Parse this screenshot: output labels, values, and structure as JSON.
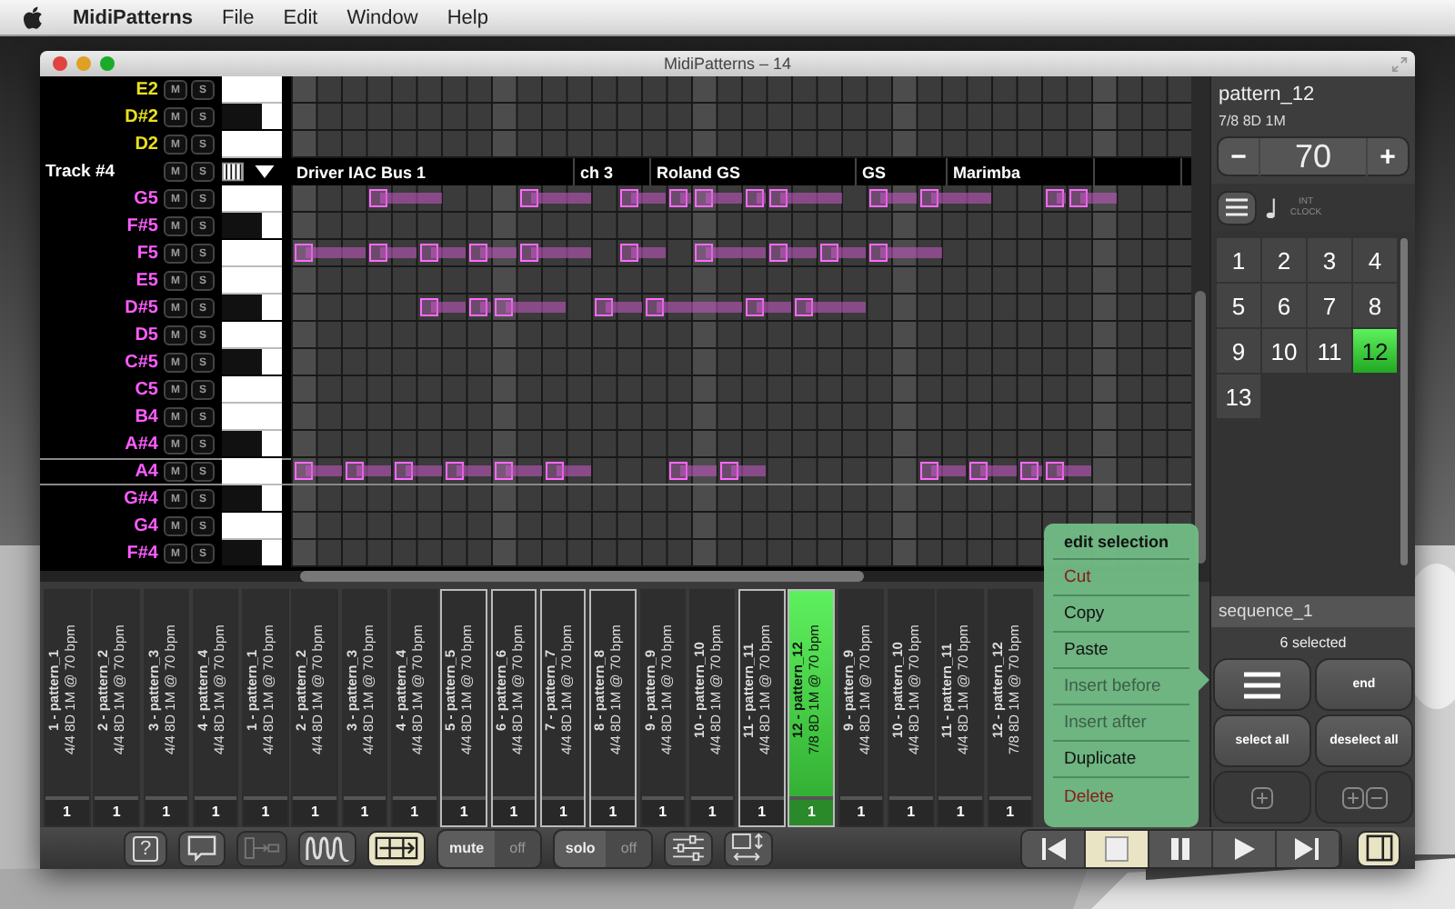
{
  "menu_bar": {
    "app": "MidiPatterns",
    "items": [
      "File",
      "Edit",
      "Window",
      "Help"
    ]
  },
  "window": {
    "title": "MidiPatterns – 14"
  },
  "tracks": [
    {
      "color": "#e8e020",
      "rows": [
        {
          "note": "E2",
          "kind": "white",
          "mute": "M",
          "solo": "S",
          "selected": false
        },
        {
          "note": "D#2",
          "kind": "black",
          "mute": "M",
          "solo": "S",
          "selected": false
        },
        {
          "note": "D2",
          "kind": "white",
          "mute": "M",
          "solo": "S",
          "selected": false
        }
      ]
    },
    {
      "color": "#ff5cff",
      "header": {
        "name": "Track #4",
        "mute": "M",
        "solo": "S",
        "segments": [
          "Driver IAC Bus 1",
          "ch 3",
          "Roland GS",
          "GS",
          "Marimba"
        ]
      },
      "rows": [
        {
          "note": "G5",
          "kind": "white",
          "mute": "M",
          "solo": "S",
          "selected": false
        },
        {
          "note": "F#5",
          "kind": "black",
          "mute": "M",
          "solo": "S",
          "selected": false
        },
        {
          "note": "F5",
          "kind": "white",
          "mute": "M",
          "solo": "S",
          "selected": false
        },
        {
          "note": "E5",
          "kind": "white",
          "mute": "M",
          "solo": "S",
          "selected": false
        },
        {
          "note": "D#5",
          "kind": "black",
          "mute": "M",
          "solo": "S",
          "selected": false
        },
        {
          "note": "D5",
          "kind": "white",
          "mute": "M",
          "solo": "S",
          "selected": false
        },
        {
          "note": "C#5",
          "kind": "black",
          "mute": "M",
          "solo": "S",
          "selected": false
        },
        {
          "note": "C5",
          "kind": "white",
          "mute": "M",
          "solo": "S",
          "selected": false
        },
        {
          "note": "B4",
          "kind": "white",
          "mute": "M",
          "solo": "S",
          "selected": false
        },
        {
          "note": "A#4",
          "kind": "black",
          "mute": "M",
          "solo": "S",
          "selected": false
        },
        {
          "note": "A4",
          "kind": "white",
          "mute": "M",
          "solo": "S",
          "selected": true
        },
        {
          "note": "G#4",
          "kind": "black",
          "mute": "M",
          "solo": "S",
          "selected": false
        },
        {
          "note": "G4",
          "kind": "white",
          "mute": "M",
          "solo": "S",
          "selected": false
        },
        {
          "note": "F#4",
          "kind": "black",
          "mute": "M",
          "solo": "S",
          "selected": false
        }
      ]
    }
  ],
  "sequence_strip": [
    {
      "name": "1 - pattern_1",
      "info": "4/4 8D 1M @ 70 bpm",
      "count": "1",
      "selected": false,
      "current": false
    },
    {
      "name": "2 - pattern_2",
      "info": "4/4 8D 1M @ 70 bpm",
      "count": "1",
      "selected": false,
      "current": false
    },
    {
      "name": "3 - pattern_3",
      "info": "4/4 8D 1M @ 70 bpm",
      "count": "1",
      "selected": false,
      "current": false
    },
    {
      "name": "4 - pattern_4",
      "info": "4/4 8D 1M @ 70 bpm",
      "count": "1",
      "selected": false,
      "current": false
    },
    {
      "name": "1 - pattern_1",
      "info": "4/4 8D 1M @ 70 bpm",
      "count": "1",
      "selected": false,
      "current": false
    },
    {
      "name": "2 - pattern_2",
      "info": "4/4 8D 1M @ 70 bpm",
      "count": "1",
      "selected": false,
      "current": false
    },
    {
      "name": "3 - pattern_3",
      "info": "4/4 8D 1M @ 70 bpm",
      "count": "1",
      "selected": false,
      "current": false
    },
    {
      "name": "4 - pattern_4",
      "info": "4/4 8D 1M @ 70 bpm",
      "count": "1",
      "selected": false,
      "current": false
    },
    {
      "name": "5 - pattern_5",
      "info": "4/4 8D 1M @ 70 bpm",
      "count": "1",
      "selected": true,
      "current": false
    },
    {
      "name": "6 - pattern_6",
      "info": "4/4 8D 1M @ 70 bpm",
      "count": "1",
      "selected": true,
      "current": false
    },
    {
      "name": "7 - pattern_7",
      "info": "4/4 8D 1M @ 70 bpm",
      "count": "1",
      "selected": true,
      "current": false
    },
    {
      "name": "8 - pattern_8",
      "info": "4/4 8D 1M @ 70 bpm",
      "count": "1",
      "selected": true,
      "current": false
    },
    {
      "name": "9 - pattern_9",
      "info": "4/4 8D 1M @ 70 bpm",
      "count": "1",
      "selected": false,
      "current": false
    },
    {
      "name": "10 - pattern_10",
      "info": "4/4 8D 1M @ 70 bpm",
      "count": "1",
      "selected": false,
      "current": false
    },
    {
      "name": "11 - pattern_11",
      "info": "4/4 8D 1M @ 70 bpm",
      "count": "1",
      "selected": true,
      "current": false
    },
    {
      "name": "12 - pattern_12",
      "info": "7/8 8D 1M @ 70 bpm",
      "count": "1",
      "selected": true,
      "current": true
    },
    {
      "name": "9 - pattern_9",
      "info": "4/4 8D 1M @ 70 bpm",
      "count": "1",
      "selected": false,
      "current": false
    },
    {
      "name": "10 - pattern_10",
      "info": "4/4 8D 1M @ 70 bpm",
      "count": "1",
      "selected": false,
      "current": false
    },
    {
      "name": "11 - pattern_11",
      "info": "4/4 8D 1M @ 70 bpm",
      "count": "1",
      "selected": false,
      "current": false
    },
    {
      "name": "12 - pattern_12",
      "info": "7/8 8D 1M @ 70 bpm",
      "count": "1",
      "selected": false,
      "current": false
    }
  ],
  "context_menu": {
    "title": "edit selection",
    "items": [
      {
        "label": "Cut",
        "disabled": false,
        "destructive": true
      },
      {
        "label": "Copy",
        "disabled": false,
        "destructive": false
      },
      {
        "label": "Paste",
        "disabled": false,
        "destructive": false
      },
      {
        "label": "Insert before",
        "disabled": true,
        "destructive": false
      },
      {
        "label": "Insert after",
        "disabled": true,
        "destructive": false
      },
      {
        "label": "Duplicate",
        "disabled": false,
        "destructive": false
      },
      {
        "label": "Delete",
        "disabled": false,
        "destructive": true
      }
    ]
  },
  "pattern_panel": {
    "name": "pattern_12",
    "meta": "7/8 8D 1M",
    "tempo": {
      "minus": "−",
      "value": "70",
      "plus": "+"
    },
    "clock": "INT CLOCK"
  },
  "pattern_buttons": [
    {
      "label": "1",
      "selected": false
    },
    {
      "label": "2",
      "selected": false
    },
    {
      "label": "3",
      "selected": false
    },
    {
      "label": "4",
      "selected": false
    },
    {
      "label": "5",
      "selected": false
    },
    {
      "label": "6",
      "selected": false
    },
    {
      "label": "7",
      "selected": false
    },
    {
      "label": "8",
      "selected": false
    },
    {
      "label": "9",
      "selected": false
    },
    {
      "label": "10",
      "selected": false
    },
    {
      "label": "11",
      "selected": false
    },
    {
      "label": "12",
      "selected": true
    },
    {
      "label": "13",
      "selected": false
    }
  ],
  "sequence_panel": {
    "name": "sequence_1",
    "count": "6 selected",
    "buttons": [
      {
        "kind": "menu"
      },
      {
        "kind": "text",
        "label": "end"
      },
      {
        "kind": "text",
        "label": "select all"
      },
      {
        "kind": "text",
        "label": "deselect all"
      },
      {
        "kind": "add"
      },
      {
        "kind": "add-remove"
      }
    ]
  },
  "toolbar": {
    "tools": [
      {
        "kind": "help",
        "glyph": "?",
        "selected": false,
        "disabled": false
      },
      {
        "kind": "comment",
        "selected": false,
        "disabled": false
      },
      {
        "kind": "link",
        "selected": false,
        "disabled": true
      },
      {
        "kind": "wave",
        "selected": false,
        "disabled": false
      },
      {
        "kind": "grid-arrow",
        "selected": true,
        "disabled": false
      }
    ],
    "toggles": [
      {
        "label": "mute",
        "value": "off",
        "on": false
      },
      {
        "label": "solo",
        "value": "off",
        "on": false
      }
    ],
    "tools2": [
      {
        "kind": "sliders"
      },
      {
        "kind": "resize"
      }
    ],
    "transport": [
      {
        "kind": "prev",
        "selected": false
      },
      {
        "kind": "stop",
        "selected": true
      },
      {
        "kind": "pause",
        "selected": false
      },
      {
        "kind": "play",
        "selected": false
      },
      {
        "kind": "next",
        "selected": false
      }
    ],
    "panel_toggle": {
      "selected": true
    }
  }
}
